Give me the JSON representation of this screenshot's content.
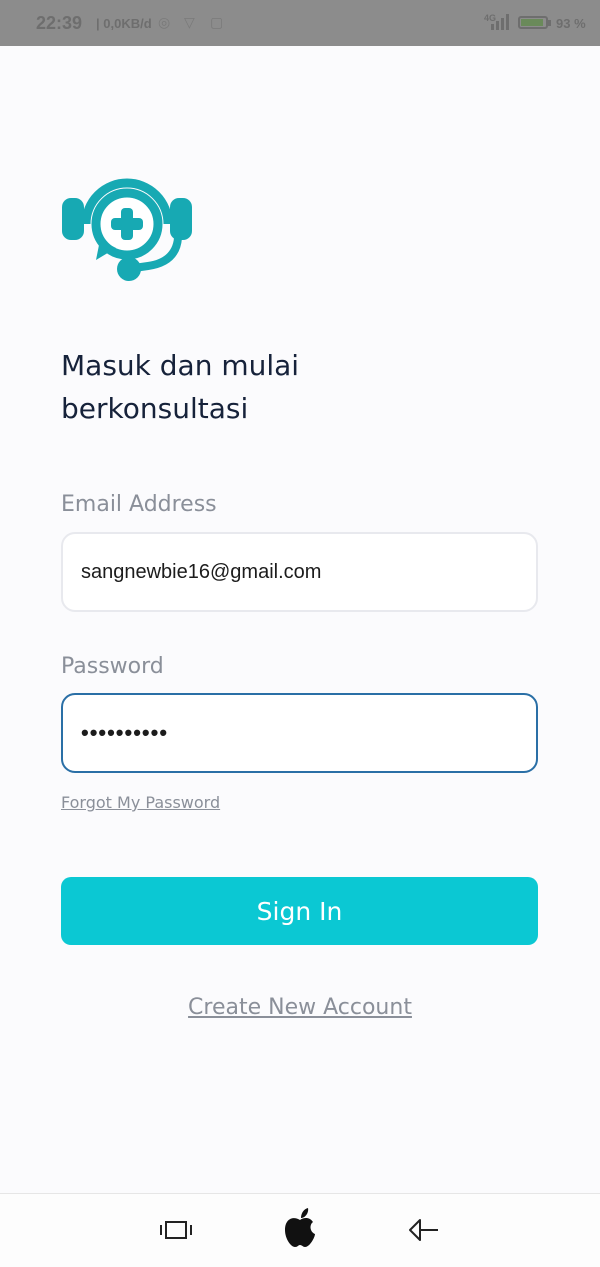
{
  "status_bar": {
    "time": "22:39",
    "speed": "0,0KB/d",
    "network": "4G",
    "battery": "93"
  },
  "logo": {
    "icon": "chat-headset-plus-icon",
    "color": "#17a9b3"
  },
  "headline": "Masuk dan mulai berkonsultasi",
  "email": {
    "label": "Email Address",
    "value": "sangnewbie16@gmail.com"
  },
  "password": {
    "label": "Password",
    "value": "••••••••••"
  },
  "forgot_link": "Forgot My Password",
  "signin_button": "Sign In",
  "create_account_link": "Create New Account",
  "nav": {
    "icons": [
      "recent-apps-icon",
      "home-apple-icon",
      "back-icon"
    ]
  },
  "colors": {
    "accent": "#0bc8d3",
    "focus_border": "#2a6fa6",
    "headline": "#16223a"
  }
}
